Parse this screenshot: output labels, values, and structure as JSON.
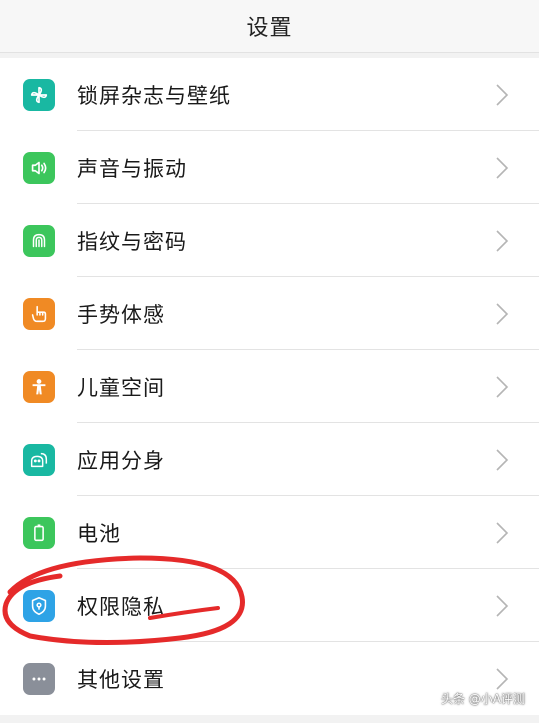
{
  "header": {
    "title": "设置"
  },
  "items": [
    {
      "label": "锁屏杂志与壁纸",
      "icon": "pinwheel-icon",
      "color": "#19b8a2"
    },
    {
      "label": "声音与振动",
      "icon": "speaker-icon",
      "color": "#3cc65c"
    },
    {
      "label": "指纹与密码",
      "icon": "fingerprint-icon",
      "color": "#3cc65c"
    },
    {
      "label": "手势体感",
      "icon": "hand-icon",
      "color": "#f08a24"
    },
    {
      "label": "儿童空间",
      "icon": "child-icon",
      "color": "#f08a24"
    },
    {
      "label": "应用分身",
      "icon": "android-icon",
      "color": "#19b8a2"
    },
    {
      "label": "电池",
      "icon": "battery-icon",
      "color": "#3cc65c"
    },
    {
      "label": "权限隐私",
      "icon": "shield-icon",
      "color": "#2ea3e6"
    },
    {
      "label": "其他设置",
      "icon": "more-icon",
      "color": "#8a8f99"
    }
  ],
  "annotation": {
    "color": "#e52a2a"
  },
  "watermark": "头条 @小A评测"
}
